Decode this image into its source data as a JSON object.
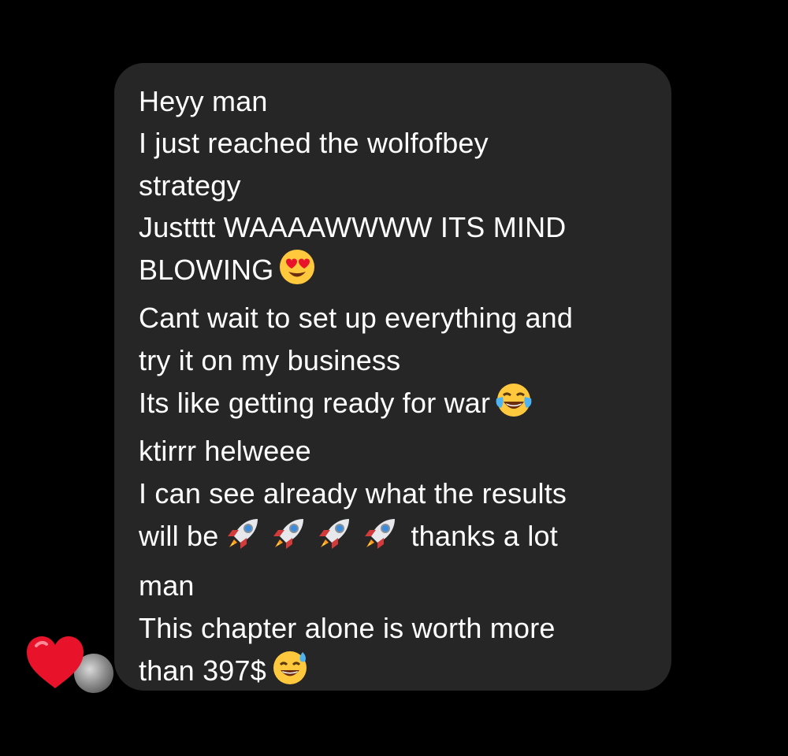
{
  "message": {
    "lines": [
      "Heyy man",
      "I just reached the wolfofbey",
      "strategy",
      "Justttt WAAAAWWWW ITS MIND",
      "BLOWING",
      "Cant wait to set up everything and",
      "try it on my business",
      "Its like getting ready for war",
      "ktirrr helweee",
      "I can see already what the results",
      "will be",
      "thanks a lot",
      "man",
      "This chapter alone is worth more",
      "than 397$"
    ],
    "icons": {
      "blowing_emoji": "heart-eyes-emoji",
      "war_emoji": "tears-of-joy-emoji",
      "results_emoji": "rocket-emoji",
      "price_emoji": "sweat-smile-emoji"
    }
  },
  "reaction": {
    "icon": "red-heart-icon",
    "color": "#e8132b"
  },
  "colors": {
    "background": "#000000",
    "bubble": "#262626",
    "text": "#ffffff"
  }
}
